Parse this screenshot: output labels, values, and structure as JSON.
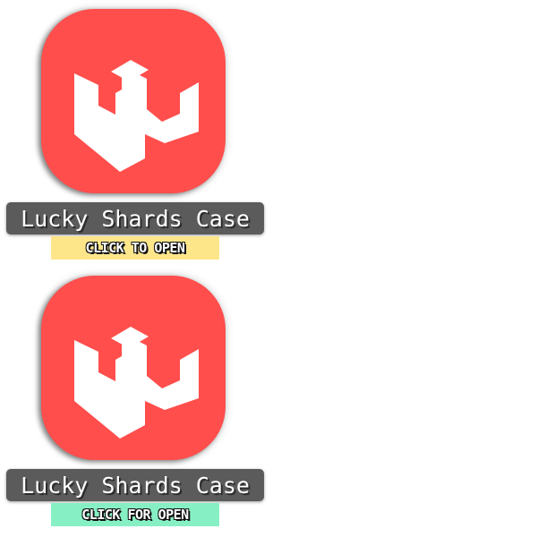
{
  "cases": [
    {
      "name": "Lucky Shards Case",
      "action_label": "CLICK TO OPEN",
      "button_color": "#fde68a",
      "icon": "lucky-shards-logo-icon"
    },
    {
      "name": "Lucky Shards Case",
      "action_label": "CLICK FOR OPEN",
      "button_color": "#86f0c4",
      "icon": "lucky-shards-logo-icon"
    }
  ],
  "colors": {
    "tile": "#ff4e4c",
    "plate": "#5b5b5b",
    "logo": "#ffffff"
  }
}
